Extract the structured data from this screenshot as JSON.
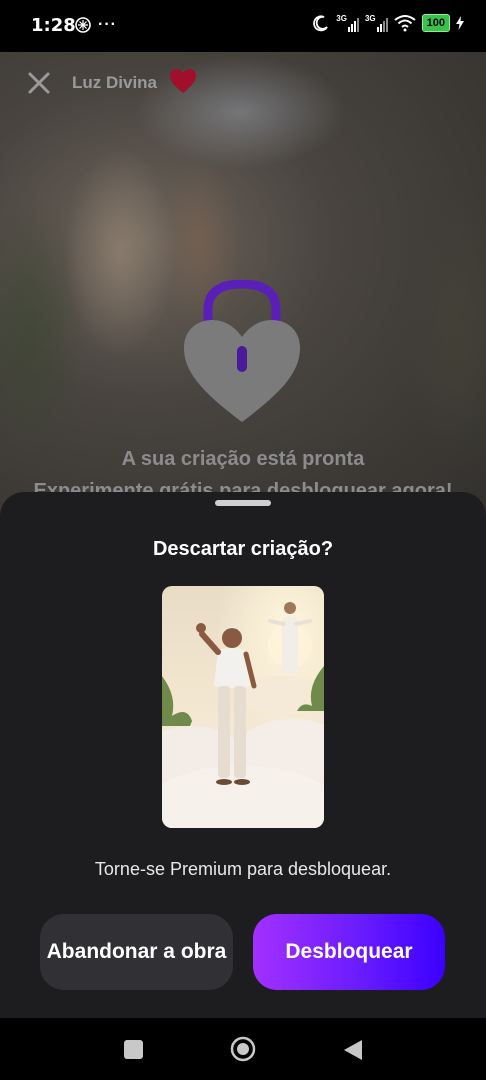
{
  "status_bar": {
    "time": "1:28",
    "more_icon_text": "···",
    "network_1": "3G",
    "network_2": "3G",
    "battery": "100"
  },
  "header": {
    "title": "Luz Divina"
  },
  "background": {
    "ready_line_1": "A sua criação está pronta",
    "ready_line_2": "Experimente grátis para desbloquear agora!"
  },
  "sheet": {
    "title": "Descartar criação?",
    "subtitle": "Torne-se Premium para desbloquear.",
    "abandon_label": "Abandonar a obra",
    "unlock_label": "Desbloquear"
  },
  "colors": {
    "accent_gradient_start": "#a330ff",
    "accent_gradient_end": "#3b00ff",
    "heart_red": "#a0102a",
    "lock_shackle": "#5a1fb8"
  },
  "icons": {
    "close": "close-icon",
    "heart": "heart-icon",
    "lock": "heart-lock-icon",
    "recents": "recents-icon",
    "home": "home-icon",
    "back": "back-icon"
  }
}
